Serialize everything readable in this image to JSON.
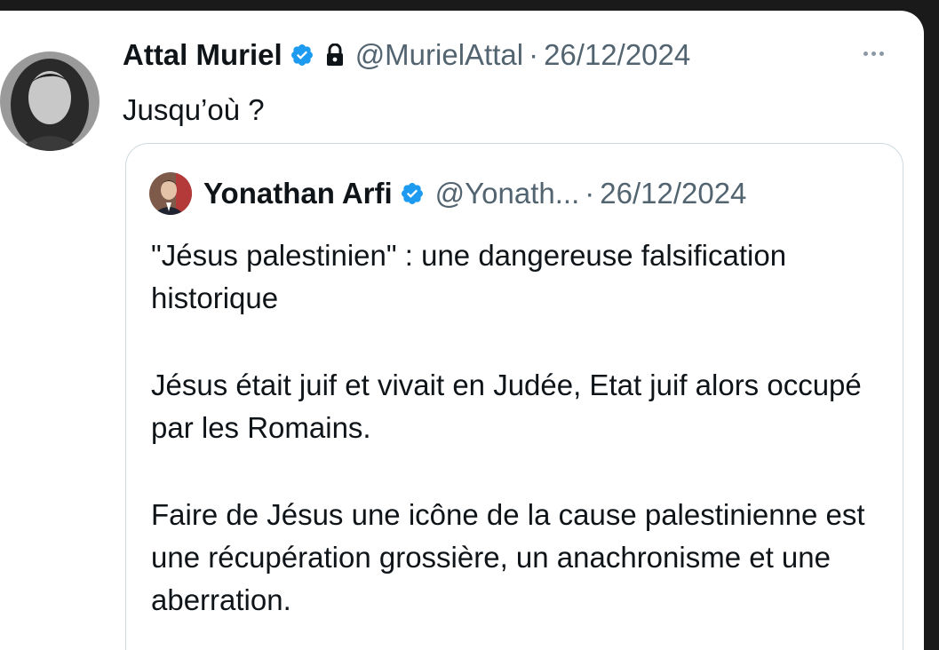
{
  "tweet": {
    "author_name": "Attal Muriel",
    "handle": "@MurielAttal",
    "separator": "·",
    "date": "26/12/2024",
    "text": "Jusqu’où ?"
  },
  "quoted_tweet": {
    "author_name": "Yonathan Arfi",
    "handle": "@Yonath...",
    "separator": "·",
    "date": "26/12/2024",
    "paragraphs": [
      "\"Jésus palestinien\" : une dangereuse falsification historique",
      "Jésus était juif et vivait en Judée, Etat juif alors occupé par les Romains.",
      "Faire de Jésus une icône de la cause palestinienne est une récupération grossière, un anachronisme et une aberration."
    ]
  },
  "icons": {
    "verified": "verified-badge-icon",
    "lock": "lock-icon",
    "more": "more-options-icon"
  },
  "colors": {
    "verified_blue": "#1d9bf0",
    "text_primary": "#0f1419",
    "text_secondary": "#536471",
    "border": "#cfd9de"
  }
}
